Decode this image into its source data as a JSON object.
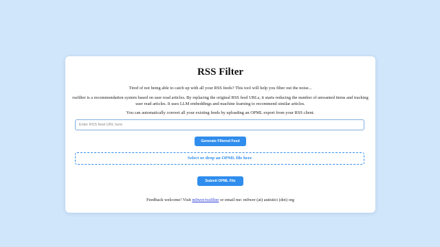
{
  "page": {
    "title": "RSS Filter",
    "intro": "Tired of not being able to catch up with all your RSS feeds? This tool will help you filter out the noise...",
    "description": "rssfilter is a recommendation system based on user read articles. By replacing the original RSS feed URLs, it starts reducing the number of unwanted items and tracking user read articles. It uses LLM embeddings and machine learning to recommend similar articles.",
    "opml_hint": "You can automatically convert all your existing feeds by uploading an OPML export from your RSS client."
  },
  "form": {
    "url_placeholder": "Enter RSS feed URL here",
    "url_value": "",
    "generate_label": "Generate Filtered Feed",
    "dropzone_label": "Select or drop an OPML file here",
    "submit_label": "Submit OPML File"
  },
  "footer": {
    "prefix": "Feedback welcome! Visit ",
    "link_text": "m0wer/rssfilter",
    "suffix": " or email me: m0wer (at) autistici (dot) org"
  },
  "colors": {
    "background": "#cfe6fb",
    "accent": "#2f8ded",
    "link": "#2a3bd6"
  }
}
